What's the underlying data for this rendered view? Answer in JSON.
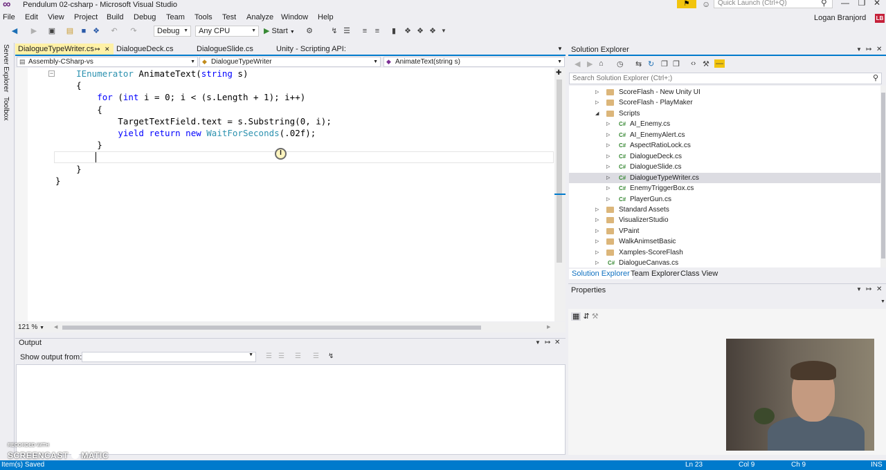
{
  "window": {
    "title": "Pendulum 02-csharp - Microsoft Visual Studio",
    "quick_launch_placeholder": "Quick Launch (Ctrl+Q)",
    "user": "Logan Branjord",
    "user_initials": "LB"
  },
  "menu": [
    "File",
    "Edit",
    "View",
    "Project",
    "Build",
    "Debug",
    "Team",
    "Tools",
    "Test",
    "Analyze",
    "Window",
    "Help"
  ],
  "toolbar": {
    "configuration": "Debug",
    "platform": "Any CPU",
    "start_label": "Start"
  },
  "left_dock": [
    "Server Explorer",
    "Toolbox"
  ],
  "editor_tabs": [
    {
      "label": "DialogueTypeWriter.cs",
      "active": true
    },
    {
      "label": "DialogueDeck.cs",
      "active": false
    },
    {
      "label": "DialogueSlide.cs",
      "active": false
    },
    {
      "label": "Unity - Scripting API:",
      "active": false
    }
  ],
  "nav_bar": {
    "project": "Assembly-CSharp-vs",
    "class": "DialogueTypeWriter",
    "member": "AnimateText(string s)"
  },
  "code_lines": [
    "    IEnumerator AnimateText(string s)",
    "    {",
    "        for (int i = 0; i < (s.Length + 1); i++)",
    "        {",
    "            TargetTextField.text = s.Substring(0, i);",
    "            yield return new WaitForSeconds(.02f);",
    "        }",
    "",
    "    }",
    "}"
  ],
  "editor_zoom": "121 %",
  "output": {
    "title": "Output",
    "show_output_from_label": "Show output from:",
    "show_output_from_value": ""
  },
  "solution_explorer": {
    "title": "Solution Explorer",
    "search_placeholder": "Search Solution Explorer (Ctrl+;)",
    "items": [
      {
        "label": "ScoreFlash - New Unity UI",
        "type": "folder",
        "level": 0,
        "expanded": false,
        "selected": false
      },
      {
        "label": "ScoreFlash - PlayMaker",
        "type": "folder",
        "level": 0,
        "expanded": false,
        "selected": false
      },
      {
        "label": "Scripts",
        "type": "folder",
        "level": 0,
        "expanded": true,
        "selected": false
      },
      {
        "label": "AI_Enemy.cs",
        "type": "cs",
        "level": 1,
        "expanded": false,
        "selected": false
      },
      {
        "label": "AI_EnemyAlert.cs",
        "type": "cs",
        "level": 1,
        "expanded": false,
        "selected": false
      },
      {
        "label": "AspectRatioLock.cs",
        "type": "cs",
        "level": 1,
        "expanded": false,
        "selected": false
      },
      {
        "label": "DialogueDeck.cs",
        "type": "cs",
        "level": 1,
        "expanded": false,
        "selected": false
      },
      {
        "label": "DialogueSlide.cs",
        "type": "cs",
        "level": 1,
        "expanded": false,
        "selected": false
      },
      {
        "label": "DialogueTypeWriter.cs",
        "type": "cs",
        "level": 1,
        "expanded": false,
        "selected": true
      },
      {
        "label": "EnemyTriggerBox.cs",
        "type": "cs",
        "level": 1,
        "expanded": false,
        "selected": false
      },
      {
        "label": "PlayerGun.cs",
        "type": "cs",
        "level": 1,
        "expanded": false,
        "selected": false
      },
      {
        "label": "Standard Assets",
        "type": "folder",
        "level": 0,
        "expanded": false,
        "selected": false
      },
      {
        "label": "VisualizerStudio",
        "type": "folder",
        "level": 0,
        "expanded": false,
        "selected": false
      },
      {
        "label": "VPaint",
        "type": "folder",
        "level": 0,
        "expanded": false,
        "selected": false
      },
      {
        "label": "WalkAnimsetBasic",
        "type": "folder",
        "level": 0,
        "expanded": false,
        "selected": false
      },
      {
        "label": "Xamples-ScoreFlash",
        "type": "folder",
        "level": 0,
        "expanded": false,
        "selected": false
      },
      {
        "label": "DialogueCanvas.cs",
        "type": "cs",
        "level": 0,
        "expanded": false,
        "selected": false
      }
    ],
    "tabs": [
      {
        "label": "Solution Explorer",
        "active": true
      },
      {
        "label": "Team Explorer",
        "active": false
      },
      {
        "label": "Class View",
        "active": false
      }
    ]
  },
  "properties": {
    "title": "Properties"
  },
  "status": {
    "message": "Item(s) Saved",
    "ln": "Ln 23",
    "col": "Col 9",
    "ch": "Ch 9",
    "mode": "INS"
  },
  "watermark": {
    "small": "RECORDED WITH",
    "brand_left": "SCREENCAST",
    "brand_right": "MATIC"
  },
  "colors": {
    "accent": "#007acc",
    "active_tab": "#fff1a6",
    "keyword": "#0000ff",
    "type": "#2b91af"
  }
}
